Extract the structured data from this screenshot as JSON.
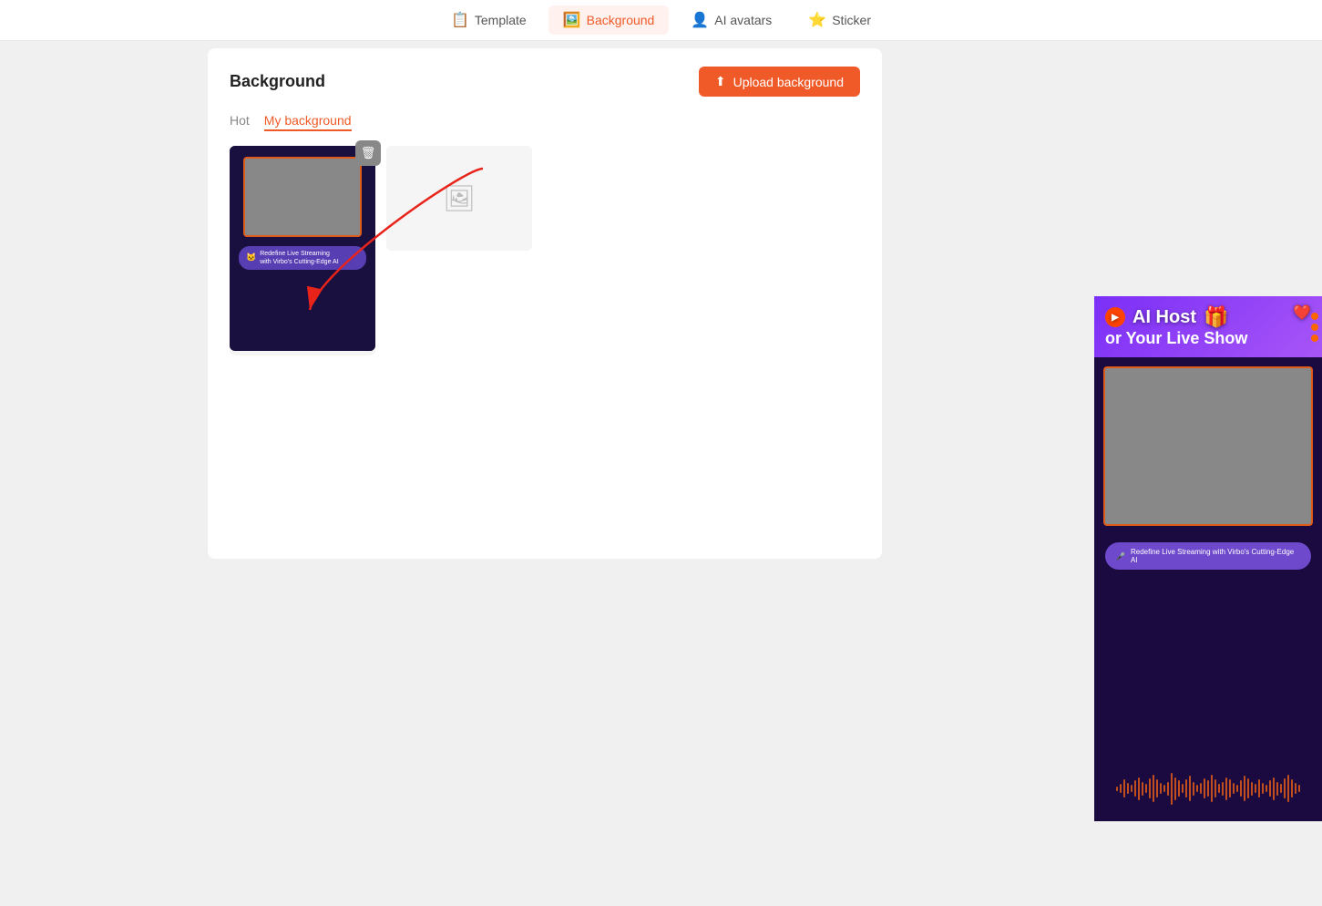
{
  "nav": {
    "items": [
      {
        "id": "template",
        "label": "Template",
        "icon": "📋",
        "active": false
      },
      {
        "id": "background",
        "label": "Background",
        "icon": "🖼️",
        "active": true
      },
      {
        "id": "ai-avatars",
        "label": "AI avatars",
        "icon": "👤",
        "active": false
      },
      {
        "id": "sticker",
        "label": "Sticker",
        "icon": "⭐",
        "active": false
      }
    ]
  },
  "panel": {
    "title": "Background",
    "upload_btn": "Upload background",
    "tabs": [
      {
        "id": "hot",
        "label": "Hot",
        "active": false
      },
      {
        "id": "my-background",
        "label": "My background",
        "active": true
      }
    ]
  },
  "preview": {
    "ai_host_line1": "AI Host",
    "ai_host_line2": "or Your Live Show",
    "redefine_text": "Redefine Live Streaming with Virbo's Cutting-Edge AI"
  },
  "waveform_bars": [
    2,
    4,
    8,
    5,
    3,
    7,
    10,
    6,
    4,
    9,
    12,
    8,
    5,
    3,
    6,
    14,
    10,
    7,
    4,
    8,
    11,
    6,
    3,
    5,
    9,
    7,
    12,
    8,
    4,
    6,
    10,
    8,
    5,
    3,
    7,
    11,
    9,
    6,
    4,
    8,
    5,
    3,
    7,
    10,
    6,
    4,
    9,
    12,
    8,
    5,
    3
  ]
}
